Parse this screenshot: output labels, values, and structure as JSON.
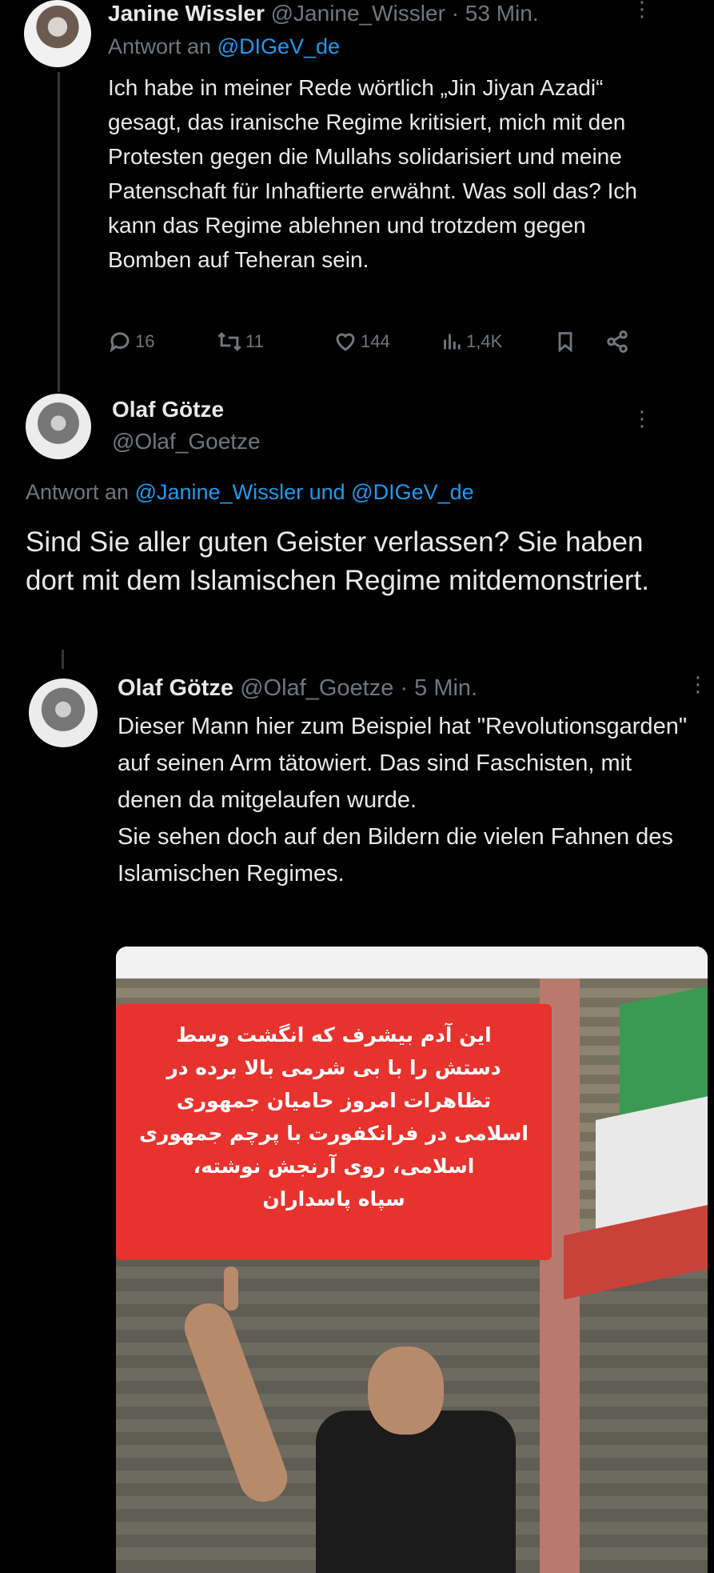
{
  "tweet1": {
    "author_name": "Janine Wissler",
    "handle": "@Janine_Wissler",
    "separator": "·",
    "time": "53 Min.",
    "reply_prefix": "Antwort an",
    "reply_to": "@DIGeV_de",
    "text": "Ich habe in meiner Rede wörtlich „Jin Jiyan Azadi“ gesagt, das iranische Regime kritisiert, mich mit den Protesten gegen die Mullahs solidarisiert und meine Patenschaft für Inhaftierte erwähnt. Was soll das? Ich kann das Regime ablehnen und trotzdem gegen Bomben auf Teheran sein.",
    "stats": {
      "replies": "16",
      "reposts": "11",
      "likes": "144",
      "views": "1,4K"
    }
  },
  "tweet2": {
    "author_name": "Olaf Götze",
    "handle": "@Olaf_Goetze",
    "reply_prefix": "Antwort an",
    "reply_to_1": "@Janine_Wissler",
    "reply_join": "und",
    "reply_to_2": "@DIGeV_de",
    "text": "Sind Sie aller guten Geister verlassen? Sie haben dort mit dem Islamischen Regime mitdemonstriert."
  },
  "tweet3": {
    "author_name": "Olaf Götze",
    "handle": "@Olaf_Goetze",
    "separator": "·",
    "time": "5 Min.",
    "text_line1": "Dieser Mann hier zum Beispiel hat \"Revolutionsgarden\" auf seinen Arm tätowiert. Das sind Faschisten, mit denen da mitgelaufen wurde.",
    "text_line2": "Sie sehen doch auf den Bildern die vielen Fahnen des Islamischen Regimes.",
    "media_banner_lines": [
      "این آدم بیشرف که انگشت وسط",
      "دستش را با بی شرمی بالا برده در",
      "تظاهرات امروز حامیان جمهوری",
      "اسلامی در فرانکفورت با پرچم جمهوری",
      "اسلامی، روی آرنجش نوشته،",
      "سپاه پاسداران"
    ]
  },
  "colors": {
    "background": "#000000",
    "text": "#e7e9ea",
    "muted": "#71767b",
    "link": "#1d9bf0",
    "banner": "#e8322d"
  }
}
